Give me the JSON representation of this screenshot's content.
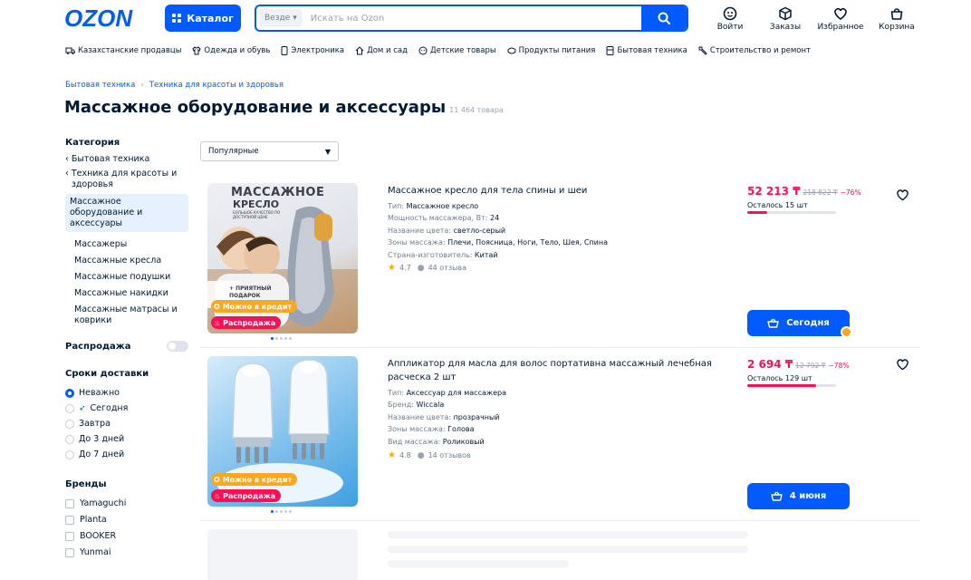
{
  "header": {
    "logo": "OZON",
    "catalog_label": "Каталог",
    "search_scope": "Везде",
    "search_placeholder": "Искать на Ozon",
    "icons": [
      {
        "label": "Войти",
        "icon": "user-icon"
      },
      {
        "label": "Заказы",
        "icon": "box-icon"
      },
      {
        "label": "Избранное",
        "icon": "heart-icon"
      },
      {
        "label": "Корзина",
        "icon": "cart-icon"
      }
    ]
  },
  "categories": [
    {
      "label": "Казахстанские продавцы",
      "icon": "truck-icon"
    },
    {
      "label": "Одежда и обувь",
      "icon": "clothes-icon"
    },
    {
      "label": "Электроника",
      "icon": "phone-icon"
    },
    {
      "label": "Дом и сад",
      "icon": "home-icon"
    },
    {
      "label": "Детские товары",
      "icon": "baby-icon"
    },
    {
      "label": "Продукты питания",
      "icon": "food-icon"
    },
    {
      "label": "Бытовая техника",
      "icon": "appliance-icon"
    },
    {
      "label": "Строительство и ремонт",
      "icon": "tools-icon"
    }
  ],
  "breadcrumbs": [
    "Бытовая техника",
    "Техника для красоты и здоровья"
  ],
  "page": {
    "title": "Массажное оборудование и аксессуары",
    "count": "11 464 товара"
  },
  "sidebar": {
    "category_title": "Категория",
    "back_links": [
      "Бытовая техника",
      "Техника для красоты и здоровья"
    ],
    "active": "Массажное оборудование и аксессуары",
    "subcategories": [
      "Массажеры",
      "Массажные кресла",
      "Массажные подушки",
      "Массажные накидки",
      "Массажные матрасы и коврики"
    ],
    "sale_label": "Распродажа",
    "sale_on": false,
    "delivery_title": "Сроки доставки",
    "delivery_options": [
      "Неважно",
      "Сегодня",
      "Завтра",
      "До 3 дней",
      "До 7 дней"
    ],
    "delivery_selected": "Неважно",
    "brands_title": "Бренды",
    "brands": [
      "Yamaguchi",
      "Planta",
      "BOOKER",
      "Yunmai"
    ]
  },
  "sort": {
    "selected": "Популярные"
  },
  "products": [
    {
      "name": "Массажное кресло для тела спины и шеи",
      "props": [
        {
          "k": "Тип:",
          "v": "Массажное кресло"
        },
        {
          "k": "Мощность массажера, Вт:",
          "v": "24"
        },
        {
          "k": "Название цвета:",
          "v": "светло-серый"
        },
        {
          "k": "Зоны массажа:",
          "v": "Плечи, Поясница, Ноги, Тело, Шея, Спина"
        },
        {
          "k": "Страна-изготовитель:",
          "v": "Китай"
        }
      ],
      "rating": "4.7",
      "reviews": "44 отзыва",
      "price": "52 213 ₸",
      "old_price": "218 822 ₸",
      "discount": "−76%",
      "stock": "Осталось 15 шт",
      "stock_level": 0.22,
      "buy_label": "Сегодня",
      "badges": [
        "Можно в кредит",
        "Распродажа"
      ],
      "image_text": {
        "line1": "МАССАЖНОЕ",
        "line2": "КРЕСЛО",
        "small": "БОЛЬШОЕ КАЧЕСТВО ПО ДОСТУПНОЙ ЦЕНЕ",
        "gift1": "+ ПРИЯТНЫЙ",
        "gift2": "ПОДАРОК"
      }
    },
    {
      "name": "Аппликатор для масла для волос портативна массажный лечебная расческа 2 шт",
      "props": [
        {
          "k": "Тип:",
          "v": "Аксессуар для массажера"
        },
        {
          "k": "Бренд:",
          "v": "Wiccala"
        },
        {
          "k": "Название цвета:",
          "v": "прозрачный"
        },
        {
          "k": "Зоны массажа:",
          "v": "Голова"
        },
        {
          "k": "Вид массажа:",
          "v": "Роликовый"
        }
      ],
      "rating": "4.8",
      "reviews": "14 отзывов",
      "price": "2 694 ₸",
      "old_price": "12 792 ₸",
      "discount": "−78%",
      "stock": "Осталось 129 шт",
      "stock_level": 0.78,
      "buy_label": "4 июня",
      "badges": [
        "Можно в кредит",
        "Распродажа"
      ]
    }
  ],
  "colors": {
    "brand": "#005bff",
    "sale": "#f91155",
    "credit": "#f8a822"
  }
}
